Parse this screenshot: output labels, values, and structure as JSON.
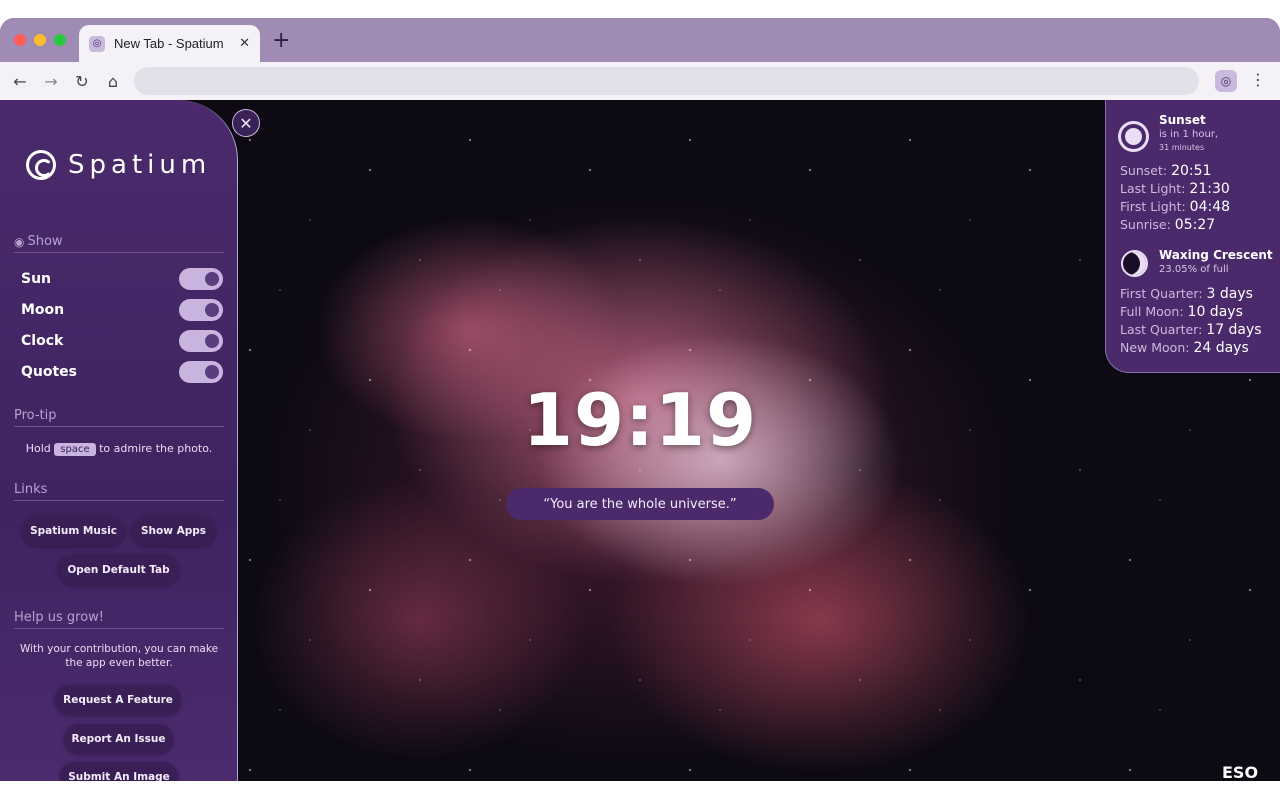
{
  "browser": {
    "tab_title": "New Tab - Spatium",
    "tab_close": "✕",
    "new_tab": "+",
    "icons": {
      "back": "←",
      "forward": "→",
      "reload": "↻",
      "home": "⌂",
      "menu": "⋮",
      "favicon": "spiral-icon"
    }
  },
  "sidebar": {
    "close": "✕",
    "brand": "Spatium",
    "show_title": "Show",
    "toggles": [
      {
        "label": "Sun",
        "on": true
      },
      {
        "label": "Moon",
        "on": true
      },
      {
        "label": "Clock",
        "on": true
      },
      {
        "label": "Quotes",
        "on": true
      }
    ],
    "protip_title": "Pro-tip",
    "protip_before": "Hold",
    "protip_key": "space",
    "protip_after": "to admire the photo.",
    "links_title": "Links",
    "links": [
      "Spatium Music",
      "Show Apps",
      "Open Default Tab"
    ],
    "help_title": "Help us grow!",
    "help_text": "With your contribution, you can make the app even better.",
    "help_buttons": [
      "Request A Feature",
      "Report An Issue",
      "Submit An Image"
    ]
  },
  "main": {
    "clock": "19:19",
    "quote": "“You are the whole universe.”",
    "credit": "ESO"
  },
  "sun": {
    "title": "Sunset",
    "sub1": "is in 1 hour,",
    "sub2": "31 minutes",
    "rows": [
      {
        "k": "Sunset:",
        "v": "20:51"
      },
      {
        "k": "Last Light:",
        "v": "21:30"
      },
      {
        "k": "First Light:",
        "v": "04:48"
      },
      {
        "k": "Sunrise:",
        "v": "05:27"
      }
    ]
  },
  "moon": {
    "title": "Waxing Crescent",
    "sub": "23.05% of full",
    "rows": [
      {
        "k": "First Quarter:",
        "v": "3 days"
      },
      {
        "k": "Full Moon:",
        "v": "10 days"
      },
      {
        "k": "Last Quarter:",
        "v": "17 days"
      },
      {
        "k": "New Moon:",
        "v": "24 days"
      }
    ]
  },
  "colors": {
    "panel": "#4a2a6b",
    "chrome": "#a08bb5",
    "toggle": "#c8b4df"
  }
}
